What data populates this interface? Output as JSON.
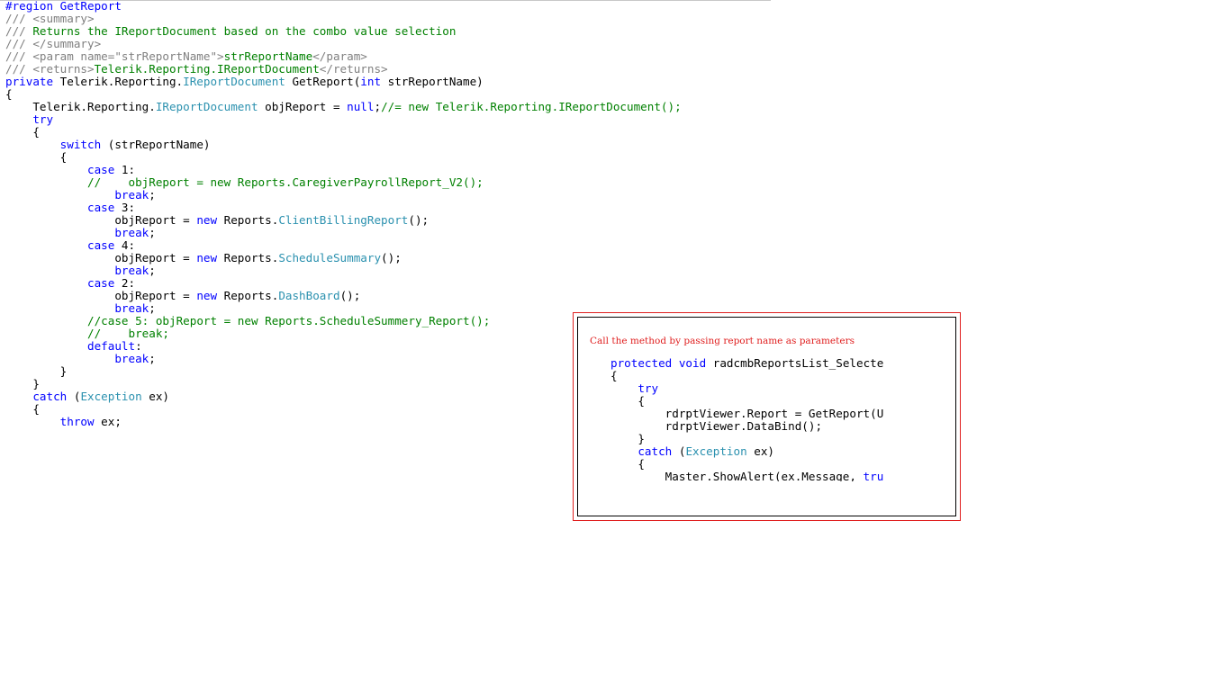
{
  "editor": {
    "lines": [
      [
        {
          "t": "#region GetReport",
          "c": "kw"
        }
      ],
      [
        {
          "t": "/// <summary>",
          "c": "gr"
        }
      ],
      [
        {
          "t": "/// ",
          "c": "gr"
        },
        {
          "t": "Returns the IReportDocument based on the combo value selection",
          "c": "cm"
        }
      ],
      [
        {
          "t": "/// </summary>",
          "c": "gr"
        }
      ],
      [
        {
          "t": "/// <param name=\"strReportName\">",
          "c": "gr"
        },
        {
          "t": "strReportName",
          "c": "cm"
        },
        {
          "t": "</param>",
          "c": "gr"
        }
      ],
      [
        {
          "t": "/// <returns>",
          "c": "gr"
        },
        {
          "t": "Telerik.Reporting.IReportDocument",
          "c": "cm"
        },
        {
          "t": "</returns>",
          "c": "gr"
        }
      ],
      [
        {
          "t": "private",
          "c": "kw"
        },
        {
          "t": " Telerik.Reporting."
        },
        {
          "t": "IReportDocument",
          "c": "ty"
        },
        {
          "t": " GetReport("
        },
        {
          "t": "int",
          "c": "kw"
        },
        {
          "t": " strReportName)"
        }
      ],
      [
        {
          "t": "{"
        }
      ],
      [
        {
          "t": "    Telerik.Reporting."
        },
        {
          "t": "IReportDocument",
          "c": "ty"
        },
        {
          "t": " objReport = "
        },
        {
          "t": "null",
          "c": "kw"
        },
        {
          "t": ";"
        },
        {
          "t": "//= new Telerik.Reporting.IReportDocument();",
          "c": "cm"
        }
      ],
      [
        {
          "t": "    "
        },
        {
          "t": "try",
          "c": "kw"
        }
      ],
      [
        {
          "t": "    {"
        }
      ],
      [
        {
          "t": "        "
        },
        {
          "t": "switch",
          "c": "kw"
        },
        {
          "t": " (strReportName)"
        }
      ],
      [
        {
          "t": "        {"
        }
      ],
      [
        {
          "t": "            "
        },
        {
          "t": "case",
          "c": "kw"
        },
        {
          "t": " 1:"
        }
      ],
      [
        {
          "t": "            "
        },
        {
          "t": "//    objReport = new Reports.CaregiverPayrollReport_V2();",
          "c": "cm"
        }
      ],
      [
        {
          "t": "                "
        },
        {
          "t": "break",
          "c": "kw"
        },
        {
          "t": ";"
        }
      ],
      [
        {
          "t": "            "
        },
        {
          "t": "case",
          "c": "kw"
        },
        {
          "t": " 3:"
        }
      ],
      [
        {
          "t": "                objReport = "
        },
        {
          "t": "new",
          "c": "kw"
        },
        {
          "t": " Reports."
        },
        {
          "t": "ClientBillingReport",
          "c": "ty"
        },
        {
          "t": "();"
        }
      ],
      [
        {
          "t": "                "
        },
        {
          "t": "break",
          "c": "kw"
        },
        {
          "t": ";"
        }
      ],
      [
        {
          "t": "            "
        },
        {
          "t": "case",
          "c": "kw"
        },
        {
          "t": " 4:"
        }
      ],
      [
        {
          "t": "                objReport = "
        },
        {
          "t": "new",
          "c": "kw"
        },
        {
          "t": " Reports."
        },
        {
          "t": "ScheduleSummary",
          "c": "ty"
        },
        {
          "t": "();"
        }
      ],
      [
        {
          "t": "                "
        },
        {
          "t": "break",
          "c": "kw"
        },
        {
          "t": ";"
        }
      ],
      [
        {
          "t": "            "
        },
        {
          "t": "case",
          "c": "kw"
        },
        {
          "t": " 2:"
        }
      ],
      [
        {
          "t": "                objReport = "
        },
        {
          "t": "new",
          "c": "kw"
        },
        {
          "t": " Reports."
        },
        {
          "t": "DashBoard",
          "c": "ty"
        },
        {
          "t": "();"
        }
      ],
      [
        {
          "t": "                "
        },
        {
          "t": "break",
          "c": "kw"
        },
        {
          "t": ";"
        }
      ],
      [
        {
          "t": "            "
        },
        {
          "t": "//case 5: objReport = new Reports.ScheduleSummery_Report();",
          "c": "cm"
        }
      ],
      [
        {
          "t": "            "
        },
        {
          "t": "//    break;",
          "c": "cm"
        }
      ],
      [
        {
          "t": "            "
        },
        {
          "t": "default",
          "c": "kw"
        },
        {
          "t": ":"
        }
      ],
      [
        {
          "t": "                "
        },
        {
          "t": "break",
          "c": "kw"
        },
        {
          "t": ";"
        }
      ],
      [
        {
          "t": "        }"
        }
      ],
      [
        {
          "t": "    }"
        }
      ],
      [
        {
          "t": "    "
        },
        {
          "t": "catch",
          "c": "kw"
        },
        {
          "t": " ("
        },
        {
          "t": "Exception",
          "c": "ty"
        },
        {
          "t": " ex)"
        }
      ],
      [
        {
          "t": "    {"
        }
      ],
      [
        {
          "t": "        "
        },
        {
          "t": "throw",
          "c": "kw"
        },
        {
          "t": " ex;"
        }
      ]
    ]
  },
  "callout": {
    "caption": "Call the method by passing report name as parameters",
    "lines": [
      [
        {
          "t": "protected",
          "c": "kw"
        },
        {
          "t": " "
        },
        {
          "t": "void",
          "c": "kw"
        },
        {
          "t": " radcmbReportsList_Selecte"
        }
      ],
      [
        {
          "t": "{"
        }
      ],
      [
        {
          "t": "    "
        },
        {
          "t": "try",
          "c": "kw"
        }
      ],
      [
        {
          "t": "    {"
        }
      ],
      [
        {
          "t": "        rdrptViewer.Report = GetReport(U"
        }
      ],
      [
        {
          "t": "        rdrptViewer.DataBind();"
        }
      ],
      [
        {
          "t": "    }"
        }
      ],
      [
        {
          "t": "    "
        },
        {
          "t": "catch",
          "c": "kw"
        },
        {
          "t": " ("
        },
        {
          "t": "Exception",
          "c": "ty"
        },
        {
          "t": " ex)"
        }
      ],
      [
        {
          "t": "    {"
        }
      ],
      [
        {
          "t": "        Master.ShowAlert(ex.Message, "
        },
        {
          "t": "tru",
          "c": "kw"
        }
      ]
    ]
  },
  "colors": {
    "keyword": "#0000ff",
    "type": "#2b91af",
    "comment": "#008000",
    "xml_doc": "#808080",
    "callout_border": "#e02020"
  }
}
